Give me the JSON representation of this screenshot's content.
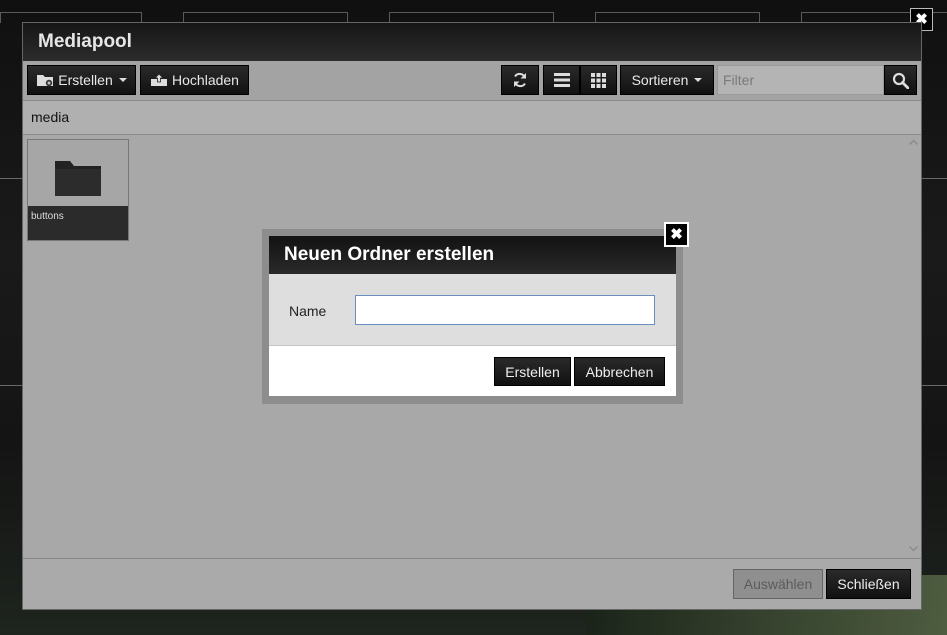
{
  "mediapool": {
    "title": "Mediapool",
    "toolbar": {
      "create_label": "Erstellen",
      "upload_label": "Hochladen",
      "sort_label": "Sortieren",
      "filter_placeholder": "Filter"
    },
    "breadcrumb": "media",
    "items": [
      {
        "label": "buttons",
        "icon": "folder-icon"
      }
    ],
    "footer": {
      "select_label": "Auswählen",
      "close_label": "Schließen"
    }
  },
  "dialog": {
    "title": "Neuen Ordner erstellen",
    "name_label": "Name",
    "name_value": "",
    "create_label": "Erstellen",
    "cancel_label": "Abbrechen"
  },
  "icons": {
    "outer_close": "close-icon",
    "dialog_close": "close-icon",
    "refresh": "refresh-icon",
    "list_view": "list-view-icon",
    "grid_view": "grid-view-icon",
    "search": "search-icon"
  },
  "colors": {
    "toolbar_button": "#1a1a1a",
    "window_bg": "#a8a8a8",
    "dialog_body": "#dedede",
    "input_border": "#6a8fbf"
  }
}
